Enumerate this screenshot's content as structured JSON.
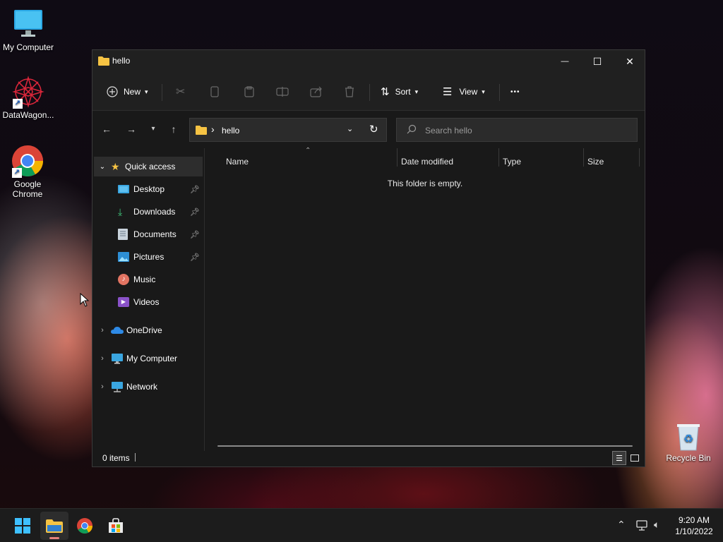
{
  "desktop": {
    "icons": [
      {
        "label": "My Computer"
      },
      {
        "label": "DataWagon..."
      },
      {
        "label": "Google Chrome"
      },
      {
        "label": "Recycle Bin"
      }
    ]
  },
  "window": {
    "title": "hello",
    "controls": {
      "minimize": "—",
      "maximize": "☐",
      "close": "✕"
    }
  },
  "toolbar": {
    "new_label": "New",
    "sort_label": "Sort",
    "view_label": "View",
    "more_label": "•••"
  },
  "address": {
    "path": "hello",
    "separator": "›"
  },
  "search": {
    "placeholder": "Search hello"
  },
  "navpane": {
    "quick_access": "Quick access",
    "items": [
      {
        "label": "Desktop"
      },
      {
        "label": "Downloads"
      },
      {
        "label": "Documents"
      },
      {
        "label": "Pictures"
      },
      {
        "label": "Music"
      },
      {
        "label": "Videos"
      }
    ],
    "onedrive": "OneDrive",
    "my_computer": "My Computer",
    "network": "Network"
  },
  "content": {
    "columns": [
      "Name",
      "Date modified",
      "Type",
      "Size"
    ],
    "empty_message": "This folder is empty."
  },
  "status": {
    "items_count": "0 items"
  },
  "taskbar": {
    "time": "9:20 AM",
    "date": "1/10/2022"
  },
  "colors": {
    "accent": "#4cc2ff",
    "folder": "#f6c343",
    "window_bg": "#191919",
    "taskbar_bg": "#1c1c1c"
  }
}
